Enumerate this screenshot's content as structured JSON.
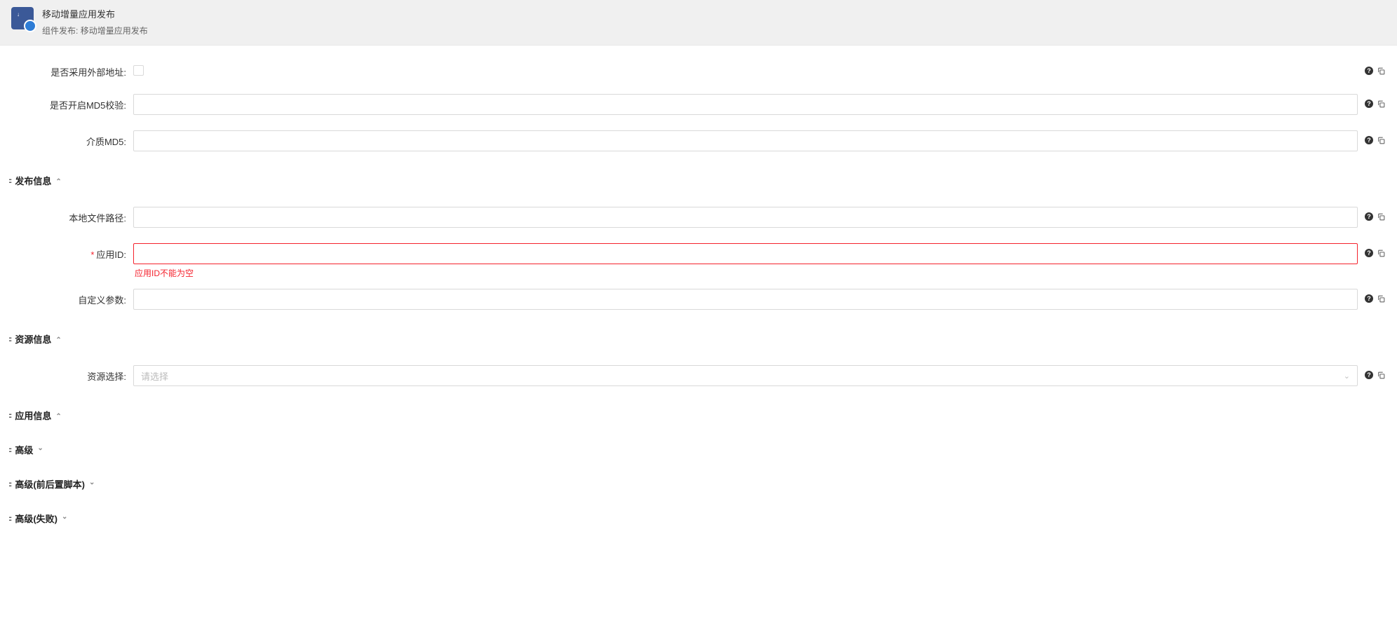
{
  "header": {
    "title": "移动增量应用发布",
    "subtitle_prefix": "组件发布:",
    "subtitle_value": "移动增量应用发布"
  },
  "fields": {
    "external_address": {
      "label": "是否采用外部地址:",
      "checked": false
    },
    "md5_check": {
      "label": "是否开启MD5校验:",
      "value": ""
    },
    "media_md5": {
      "label": "介质MD5:",
      "value": ""
    },
    "local_path": {
      "label": "本地文件路径:",
      "value": ""
    },
    "app_id": {
      "label": "应用ID:",
      "value": "",
      "error": "应用ID不能为空"
    },
    "custom_params": {
      "label": "自定义参数:",
      "value": ""
    },
    "resource_select": {
      "label": "资源选择:",
      "placeholder": "请选择"
    }
  },
  "sections": {
    "publish_info": {
      "title": "发布信息",
      "expanded": true
    },
    "resource_info": {
      "title": "资源信息",
      "expanded": true
    },
    "app_info": {
      "title": "应用信息",
      "expanded": true
    },
    "advanced": {
      "title": "高级",
      "expanded": false
    },
    "advanced_scripts": {
      "title": "高级(前后置脚本)",
      "expanded": false
    },
    "advanced_fail": {
      "title": "高级(失败)",
      "expanded": false
    }
  }
}
